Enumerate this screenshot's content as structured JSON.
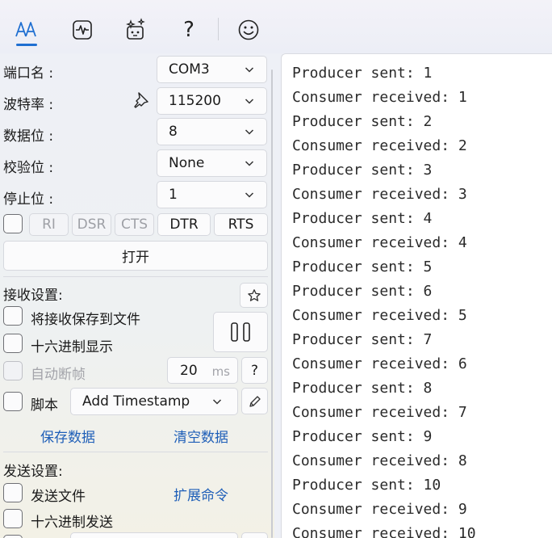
{
  "toolbar": {
    "items": [
      {
        "icon": "text-format-icon"
      },
      {
        "icon": "pulse-icon"
      },
      {
        "icon": "sparkle-bot-icon"
      },
      {
        "icon": "help-icon"
      },
      {
        "icon": "smiley-icon"
      }
    ],
    "help_glyph": "?"
  },
  "serial": {
    "port_label": "端口名 :",
    "port_value": "COM3",
    "baud_label": "波特率 :",
    "baud_value": "115200",
    "databits_label": "数据位 :",
    "databits_value": "8",
    "parity_label": "校验位 :",
    "parity_value": "None",
    "stopbits_label": "停止位 :",
    "stopbits_value": "1",
    "signals": [
      "RI",
      "DSR",
      "CTS",
      "DTR",
      "RTS"
    ],
    "open_button": "打开"
  },
  "receive": {
    "title": "接收设置:",
    "save_to_file": "将接收保存到文件",
    "hex_display": "十六进制显示",
    "auto_frame": "自动断帧",
    "frame_ms_value": "20",
    "frame_ms_unit": "ms",
    "help_glyph": "?",
    "script_label": "脚本",
    "script_value": "Add Timestamp",
    "save_data_link": "保存数据",
    "clear_data_link": "清空数据"
  },
  "send": {
    "title": "发送设置:",
    "send_file": "发送文件",
    "extend_command_link": "扩展命令",
    "hex_send": "十六进制发送"
  },
  "output": {
    "lines": [
      "Producer sent: 1",
      "Consumer received: 1",
      "Producer sent: 2",
      "Consumer received: 2",
      "Producer sent: 3",
      "Consumer received: 3",
      "Producer sent: 4",
      "Consumer received: 4",
      "Producer sent: 5",
      "Producer sent: 6",
      "Consumer received: 5",
      "Producer sent: 7",
      "Consumer received: 6",
      "Producer sent: 8",
      "Consumer received: 7",
      "Producer sent: 9",
      "Consumer received: 8",
      "Producer sent: 10",
      "Consumer received: 9",
      "Consumer received: 10"
    ]
  },
  "colors": {
    "accent": "#1f6fd1",
    "link": "#1f5fb8"
  }
}
